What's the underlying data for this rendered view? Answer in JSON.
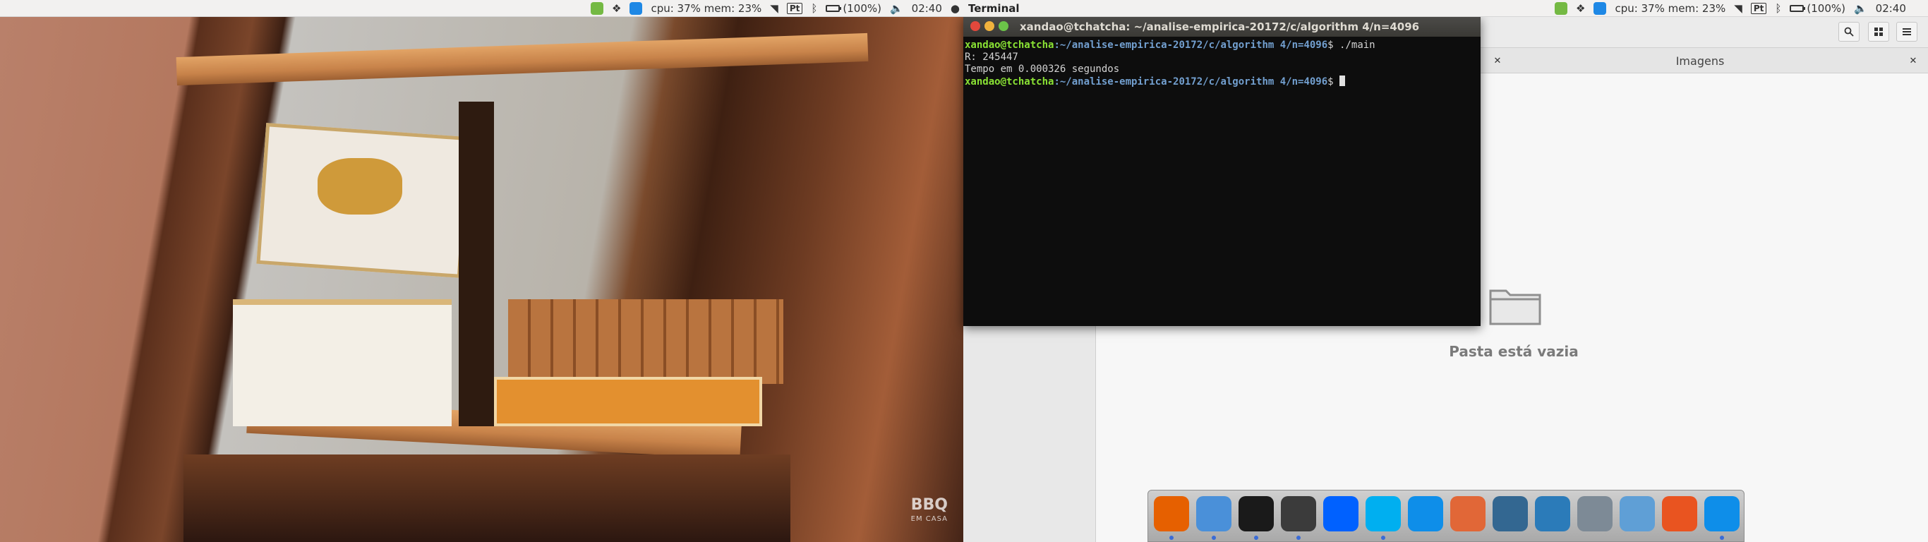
{
  "menubar": {
    "app_name": "Terminal",
    "left_tray": {
      "cpu_mem": "cpu: 37% mem: 23%",
      "lang": "Pt",
      "battery": "(100%)",
      "time": "02:40"
    },
    "right_tray": {
      "cpu_mem": "cpu: 37% mem: 23%",
      "lang": "Pt",
      "battery": "(100%)",
      "time": "02:40"
    }
  },
  "video": {
    "watermark_main": "BBQ",
    "watermark_sub": "EM CASA"
  },
  "terminal": {
    "title": "xandao@tchatcha: ~/analise-empirica-20172/c/algorithm 4/n=4096",
    "prompt_user": "xandao@tchatcha",
    "prompt_path": ":~/analise-empirica-20172/c/algorithm 4/n=4096",
    "prompt_suffix": "$ ",
    "command": "./main",
    "output_1": "R: 245447",
    "output_2": "Tempo em 0.000326 segundos"
  },
  "file_manager": {
    "tab_label": "Imagens",
    "empty_message": "Pasta está vazia"
  },
  "dock": {
    "items": [
      "firefox-icon",
      "finder-icon",
      "terminal-icon",
      "code-editor-icon",
      "dropbox-icon",
      "skype-icon",
      "teamviewer-icon",
      "matlab-icon",
      "postgresql-icon",
      "mysql-workbench-icon",
      "screenshot-icon",
      "virtualbox-icon",
      "ubuntu-software-icon",
      "teamviewer-icon"
    ],
    "colors": {
      "accent": "#3a6bd6",
      "firefox": "#e66000",
      "terminal": "#1a1a1a",
      "dropbox": "#0061ff",
      "skype": "#00aff0",
      "teamviewer": "#0e8ee9",
      "matlab": "#e16737",
      "postgres": "#336791",
      "virtualbox": "#5f9fd6",
      "ubuntu": "#e95420"
    }
  }
}
